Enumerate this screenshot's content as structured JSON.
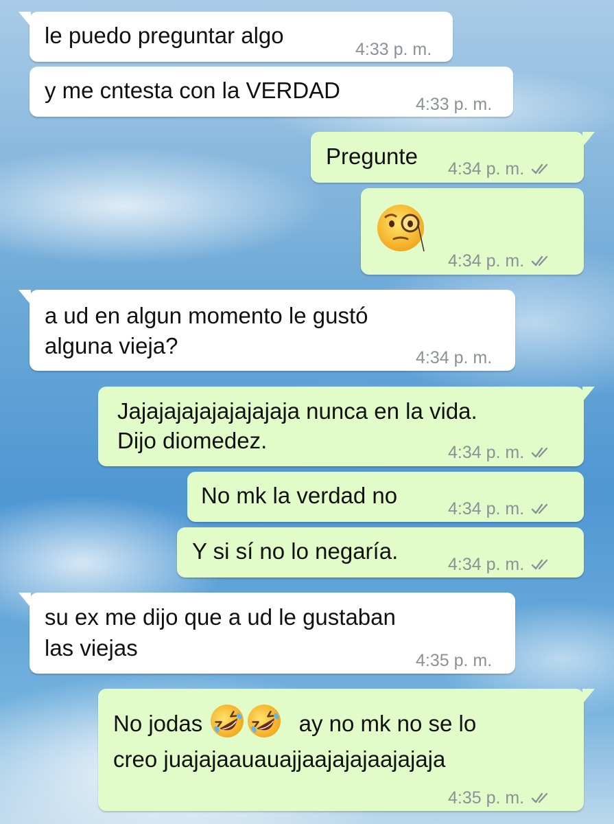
{
  "messages": [
    {
      "dir": "in",
      "text": "le puedo preguntar algo",
      "time": "4:33 p. m."
    },
    {
      "dir": "in",
      "text": "y me cntesta con la VERDAD",
      "time": "4:33 p. m."
    },
    {
      "dir": "out",
      "text": "Pregunte",
      "time": "4:34 p. m.",
      "status": "read"
    },
    {
      "dir": "out",
      "emoji": "face-with-monocle-emoji",
      "time": "4:34 p. m.",
      "status": "read"
    },
    {
      "dir": "in",
      "lines": [
        "a ud en algun momento le gustó",
        "alguna vieja?"
      ],
      "time": "4:34 p. m."
    },
    {
      "dir": "out",
      "lines": [
        "Jajajajajajajajajaja nunca en la vida.",
        "Dijo diomedez."
      ],
      "time": "4:34 p. m.",
      "status": "read"
    },
    {
      "dir": "out",
      "text": "No mk la verdad no",
      "time": "4:34 p. m.",
      "status": "read"
    },
    {
      "dir": "out",
      "text": "Y si sí no lo negaría.",
      "time": "4:34 p. m.",
      "status": "read"
    },
    {
      "dir": "in",
      "lines": [
        "su ex me dijo que a ud le gustaban",
        "las viejas"
      ],
      "time": "4:35 p. m."
    },
    {
      "dir": "out",
      "lines_parts": [
        "No jodas",
        "ay no mk no se lo",
        "creo juajajaauauajjaajajajaajajaja"
      ],
      "emojis": [
        "rolling-on-floor-laughing-emoji",
        "rolling-on-floor-laughing-emoji"
      ],
      "time": "4:35 p. m.",
      "status": "read"
    }
  ],
  "colors": {
    "incoming_bubble": "#ffffff",
    "outgoing_bubble": "#e2fcc9",
    "timestamp": "#8a9197"
  }
}
